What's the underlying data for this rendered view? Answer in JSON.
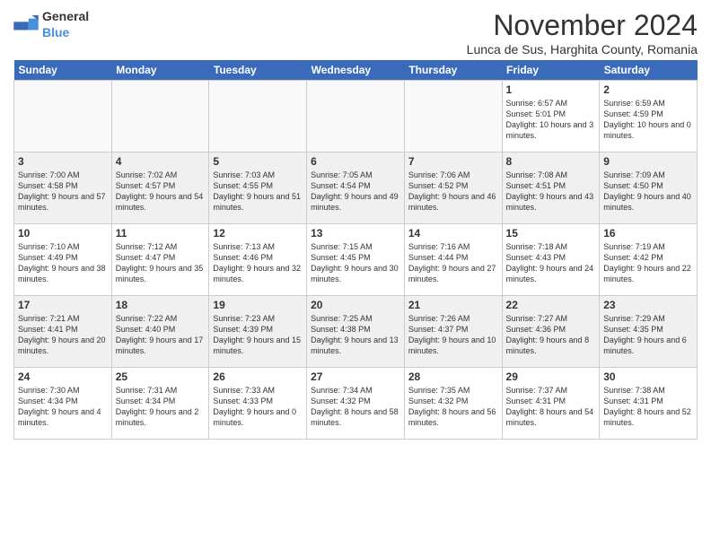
{
  "logo": {
    "general": "General",
    "blue": "Blue"
  },
  "title": "November 2024",
  "subtitle": "Lunca de Sus, Harghita County, Romania",
  "headers": [
    "Sunday",
    "Monday",
    "Tuesday",
    "Wednesday",
    "Thursday",
    "Friday",
    "Saturday"
  ],
  "weeks": [
    [
      {
        "day": "",
        "info": "",
        "empty": true
      },
      {
        "day": "",
        "info": "",
        "empty": true
      },
      {
        "day": "",
        "info": "",
        "empty": true
      },
      {
        "day": "",
        "info": "",
        "empty": true
      },
      {
        "day": "",
        "info": "",
        "empty": true
      },
      {
        "day": "1",
        "info": "Sunrise: 6:57 AM\nSunset: 5:01 PM\nDaylight: 10 hours and 3 minutes."
      },
      {
        "day": "2",
        "info": "Sunrise: 6:59 AM\nSunset: 4:59 PM\nDaylight: 10 hours and 0 minutes."
      }
    ],
    [
      {
        "day": "3",
        "info": "Sunrise: 7:00 AM\nSunset: 4:58 PM\nDaylight: 9 hours and 57 minutes."
      },
      {
        "day": "4",
        "info": "Sunrise: 7:02 AM\nSunset: 4:57 PM\nDaylight: 9 hours and 54 minutes."
      },
      {
        "day": "5",
        "info": "Sunrise: 7:03 AM\nSunset: 4:55 PM\nDaylight: 9 hours and 51 minutes."
      },
      {
        "day": "6",
        "info": "Sunrise: 7:05 AM\nSunset: 4:54 PM\nDaylight: 9 hours and 49 minutes."
      },
      {
        "day": "7",
        "info": "Sunrise: 7:06 AM\nSunset: 4:52 PM\nDaylight: 9 hours and 46 minutes."
      },
      {
        "day": "8",
        "info": "Sunrise: 7:08 AM\nSunset: 4:51 PM\nDaylight: 9 hours and 43 minutes."
      },
      {
        "day": "9",
        "info": "Sunrise: 7:09 AM\nSunset: 4:50 PM\nDaylight: 9 hours and 40 minutes."
      }
    ],
    [
      {
        "day": "10",
        "info": "Sunrise: 7:10 AM\nSunset: 4:49 PM\nDaylight: 9 hours and 38 minutes."
      },
      {
        "day": "11",
        "info": "Sunrise: 7:12 AM\nSunset: 4:47 PM\nDaylight: 9 hours and 35 minutes."
      },
      {
        "day": "12",
        "info": "Sunrise: 7:13 AM\nSunset: 4:46 PM\nDaylight: 9 hours and 32 minutes."
      },
      {
        "day": "13",
        "info": "Sunrise: 7:15 AM\nSunset: 4:45 PM\nDaylight: 9 hours and 30 minutes."
      },
      {
        "day": "14",
        "info": "Sunrise: 7:16 AM\nSunset: 4:44 PM\nDaylight: 9 hours and 27 minutes."
      },
      {
        "day": "15",
        "info": "Sunrise: 7:18 AM\nSunset: 4:43 PM\nDaylight: 9 hours and 24 minutes."
      },
      {
        "day": "16",
        "info": "Sunrise: 7:19 AM\nSunset: 4:42 PM\nDaylight: 9 hours and 22 minutes."
      }
    ],
    [
      {
        "day": "17",
        "info": "Sunrise: 7:21 AM\nSunset: 4:41 PM\nDaylight: 9 hours and 20 minutes."
      },
      {
        "day": "18",
        "info": "Sunrise: 7:22 AM\nSunset: 4:40 PM\nDaylight: 9 hours and 17 minutes."
      },
      {
        "day": "19",
        "info": "Sunrise: 7:23 AM\nSunset: 4:39 PM\nDaylight: 9 hours and 15 minutes."
      },
      {
        "day": "20",
        "info": "Sunrise: 7:25 AM\nSunset: 4:38 PM\nDaylight: 9 hours and 13 minutes."
      },
      {
        "day": "21",
        "info": "Sunrise: 7:26 AM\nSunset: 4:37 PM\nDaylight: 9 hours and 10 minutes."
      },
      {
        "day": "22",
        "info": "Sunrise: 7:27 AM\nSunset: 4:36 PM\nDaylight: 9 hours and 8 minutes."
      },
      {
        "day": "23",
        "info": "Sunrise: 7:29 AM\nSunset: 4:35 PM\nDaylight: 9 hours and 6 minutes."
      }
    ],
    [
      {
        "day": "24",
        "info": "Sunrise: 7:30 AM\nSunset: 4:34 PM\nDaylight: 9 hours and 4 minutes."
      },
      {
        "day": "25",
        "info": "Sunrise: 7:31 AM\nSunset: 4:34 PM\nDaylight: 9 hours and 2 minutes."
      },
      {
        "day": "26",
        "info": "Sunrise: 7:33 AM\nSunset: 4:33 PM\nDaylight: 9 hours and 0 minutes."
      },
      {
        "day": "27",
        "info": "Sunrise: 7:34 AM\nSunset: 4:32 PM\nDaylight: 8 hours and 58 minutes."
      },
      {
        "day": "28",
        "info": "Sunrise: 7:35 AM\nSunset: 4:32 PM\nDaylight: 8 hours and 56 minutes."
      },
      {
        "day": "29",
        "info": "Sunrise: 7:37 AM\nSunset: 4:31 PM\nDaylight: 8 hours and 54 minutes."
      },
      {
        "day": "30",
        "info": "Sunrise: 7:38 AM\nSunset: 4:31 PM\nDaylight: 8 hours and 52 minutes."
      }
    ]
  ]
}
